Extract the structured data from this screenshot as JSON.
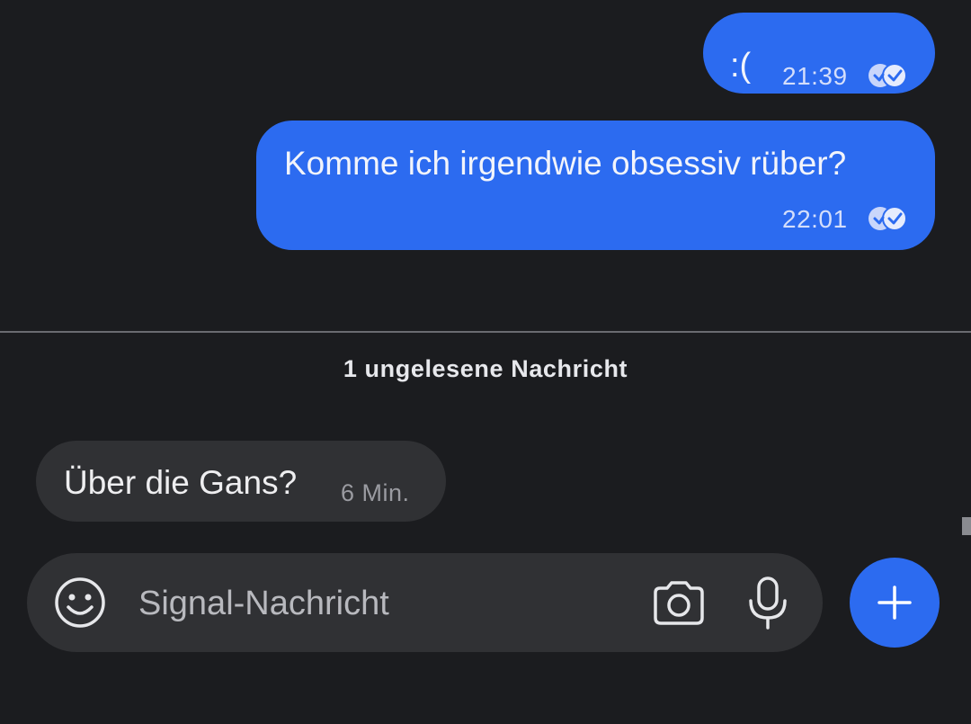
{
  "colors": {
    "background": "#1b1c1f",
    "outgoing_bubble": "#2c6bf0",
    "incoming_bubble": "#303134",
    "accent": "#2c6bf0"
  },
  "messages": [
    {
      "direction": "outgoing",
      "text": ":(",
      "time": "21:39",
      "status_icon": "read-receipt-icon"
    },
    {
      "direction": "outgoing",
      "text": "Komme ich irgendwie obsessiv rüber?",
      "time": "22:01",
      "status_icon": "read-receipt-icon"
    },
    {
      "direction": "incoming",
      "text": "Über die Gans?",
      "time": "6 Min."
    }
  ],
  "unread_divider": {
    "label": "1 ungelesene Nachricht"
  },
  "composer": {
    "placeholder": "Signal-Nachricht",
    "value": "",
    "icons": {
      "emoji": "emoji-icon",
      "camera": "camera-icon",
      "mic": "microphone-icon",
      "attach": "plus-icon"
    }
  }
}
